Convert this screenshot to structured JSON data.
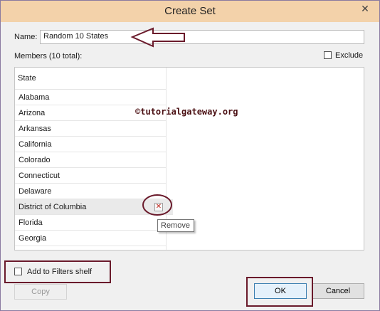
{
  "window": {
    "title": "Create Set",
    "close_glyph": "✕"
  },
  "name_field": {
    "label": "Name:",
    "value": "Random 10 States"
  },
  "members": {
    "label": "Members (10 total):"
  },
  "exclude": {
    "label": "Exclude",
    "checked": false
  },
  "list": {
    "column_header": "State",
    "rows": [
      "Alabama",
      "Arizona",
      "Arkansas",
      "California",
      "Colorado",
      "Connecticut",
      "Delaware",
      "District of Columbia",
      "Florida",
      "Georgia"
    ],
    "remove_glyph": "✕",
    "tooltip": "Remove"
  },
  "watermark": "©tutorialgateway.org",
  "add_to_filters": {
    "label": "Add to Filters shelf",
    "checked": false
  },
  "buttons": {
    "copy": "Copy",
    "ok": "OK",
    "cancel": "Cancel"
  },
  "colors": {
    "annotation": "#6a1a2b",
    "titlebar": "#f3d2aa"
  }
}
